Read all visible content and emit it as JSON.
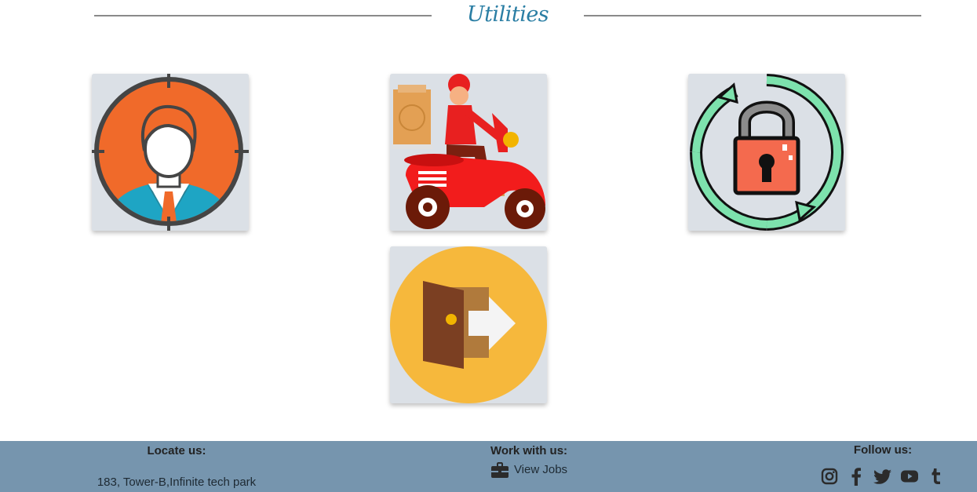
{
  "heading": {
    "title": "Utilities"
  },
  "tiles": [
    {
      "name": "profile-tile",
      "icon": "user-target-icon"
    },
    {
      "name": "delivery-tile",
      "icon": "delivery-scooter-icon"
    },
    {
      "name": "password-tile",
      "icon": "lock-refresh-icon"
    },
    {
      "name": "logout-tile",
      "icon": "exit-door-icon"
    }
  ],
  "footer": {
    "locate": {
      "heading": "Locate us:",
      "address": "183, Tower-B,Infinite tech park"
    },
    "work": {
      "heading": "Work with us:",
      "link": "View Jobs",
      "icon": "briefcase-icon"
    },
    "follow": {
      "heading": "Follow us:",
      "icons": [
        "instagram-icon",
        "facebook-icon",
        "twitter-icon",
        "youtube-icon",
        "tumblr-icon"
      ]
    }
  },
  "colors": {
    "heading": "#2a7ea4",
    "footer_bg": "#7695ae",
    "tile_bg": "#dbe0e6"
  }
}
